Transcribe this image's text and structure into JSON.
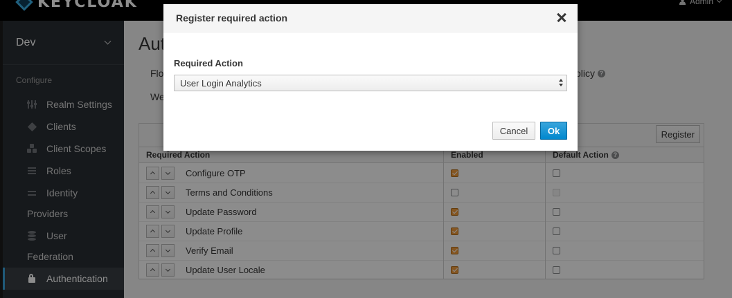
{
  "header": {
    "brand": "KEYCLOAK",
    "user": "Admin"
  },
  "sidebar": {
    "realm": "Dev",
    "section": "Configure",
    "items": [
      {
        "label": "Realm Settings",
        "icon": "sliders-icon"
      },
      {
        "label": "Clients",
        "icon": "cube-icon"
      },
      {
        "label": "Client Scopes",
        "icon": "cubes-icon"
      },
      {
        "label": "Roles",
        "icon": "list-icon"
      },
      {
        "label": "Identity",
        "label2": "Providers",
        "icon": "exchange-icon"
      },
      {
        "label": "User",
        "label2": "Federation",
        "icon": "database-icon"
      },
      {
        "label": "Authentication",
        "icon": "lock-icon"
      }
    ]
  },
  "main": {
    "title": "Aut",
    "tab_row1": "Flo",
    "tab_row2": "We",
    "tab_policy": "olicy",
    "register_label": "Register",
    "table": {
      "headers": [
        "Required Action",
        "Enabled",
        "Default Action"
      ],
      "rows": [
        {
          "name": "Configure OTP",
          "enabled": true,
          "default": false,
          "default_disabled": false
        },
        {
          "name": "Terms and Conditions",
          "enabled": false,
          "default": false,
          "default_disabled": true
        },
        {
          "name": "Update Password",
          "enabled": true,
          "default": false,
          "default_disabled": false
        },
        {
          "name": "Update Profile",
          "enabled": true,
          "default": false,
          "default_disabled": false
        },
        {
          "name": "Verify Email",
          "enabled": true,
          "default": false,
          "default_disabled": false
        },
        {
          "name": "Update User Locale",
          "enabled": true,
          "default": false,
          "default_disabled": false
        }
      ]
    }
  },
  "modal": {
    "title": "Register required action",
    "field_label": "Required Action",
    "selected_value": "User Login Analytics",
    "cancel_label": "Cancel",
    "ok_label": "Ok"
  },
  "colors": {
    "primary": "#0088ce",
    "checkbox_checked": "#f39d3c",
    "sidebar_bg": "#292e34",
    "active_marker": "#39a5dc"
  }
}
